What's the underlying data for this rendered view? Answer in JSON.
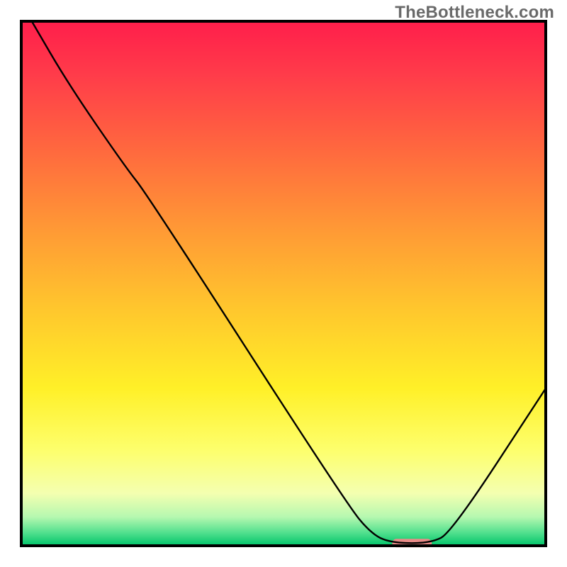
{
  "watermark": "TheBottleneck.com",
  "chart_data": {
    "type": "line",
    "title": "",
    "xlabel": "",
    "ylabel": "",
    "xlim": [
      0,
      100
    ],
    "ylim": [
      0,
      100
    ],
    "background_gradient": {
      "stops": [
        {
          "offset": 0.0,
          "color": "#ff1e4b"
        },
        {
          "offset": 0.1,
          "color": "#ff3b4a"
        },
        {
          "offset": 0.25,
          "color": "#ff6a3e"
        },
        {
          "offset": 0.4,
          "color": "#ff9a35"
        },
        {
          "offset": 0.55,
          "color": "#ffc72d"
        },
        {
          "offset": 0.7,
          "color": "#fff028"
        },
        {
          "offset": 0.82,
          "color": "#fdff6e"
        },
        {
          "offset": 0.9,
          "color": "#f4ffb0"
        },
        {
          "offset": 0.945,
          "color": "#b6f8b0"
        },
        {
          "offset": 0.975,
          "color": "#52e08e"
        },
        {
          "offset": 1.0,
          "color": "#00c46a"
        }
      ]
    },
    "series": [
      {
        "name": "bottleneck-curve",
        "points": [
          {
            "x": 2.0,
            "y": 100.0
          },
          {
            "x": 9.0,
            "y": 88.0
          },
          {
            "x": 20.0,
            "y": 72.0
          },
          {
            "x": 24.0,
            "y": 67.0
          },
          {
            "x": 62.0,
            "y": 8.0
          },
          {
            "x": 67.0,
            "y": 2.0
          },
          {
            "x": 71.0,
            "y": 0.5
          },
          {
            "x": 78.0,
            "y": 0.5
          },
          {
            "x": 82.0,
            "y": 2.5
          },
          {
            "x": 100.0,
            "y": 30.0
          }
        ]
      }
    ],
    "optimal_marker": {
      "x_start": 71.0,
      "x_end": 78.0,
      "y": 0.5,
      "color": "#e88a87"
    },
    "frame": {
      "color": "#000000",
      "thickness": 4
    }
  }
}
